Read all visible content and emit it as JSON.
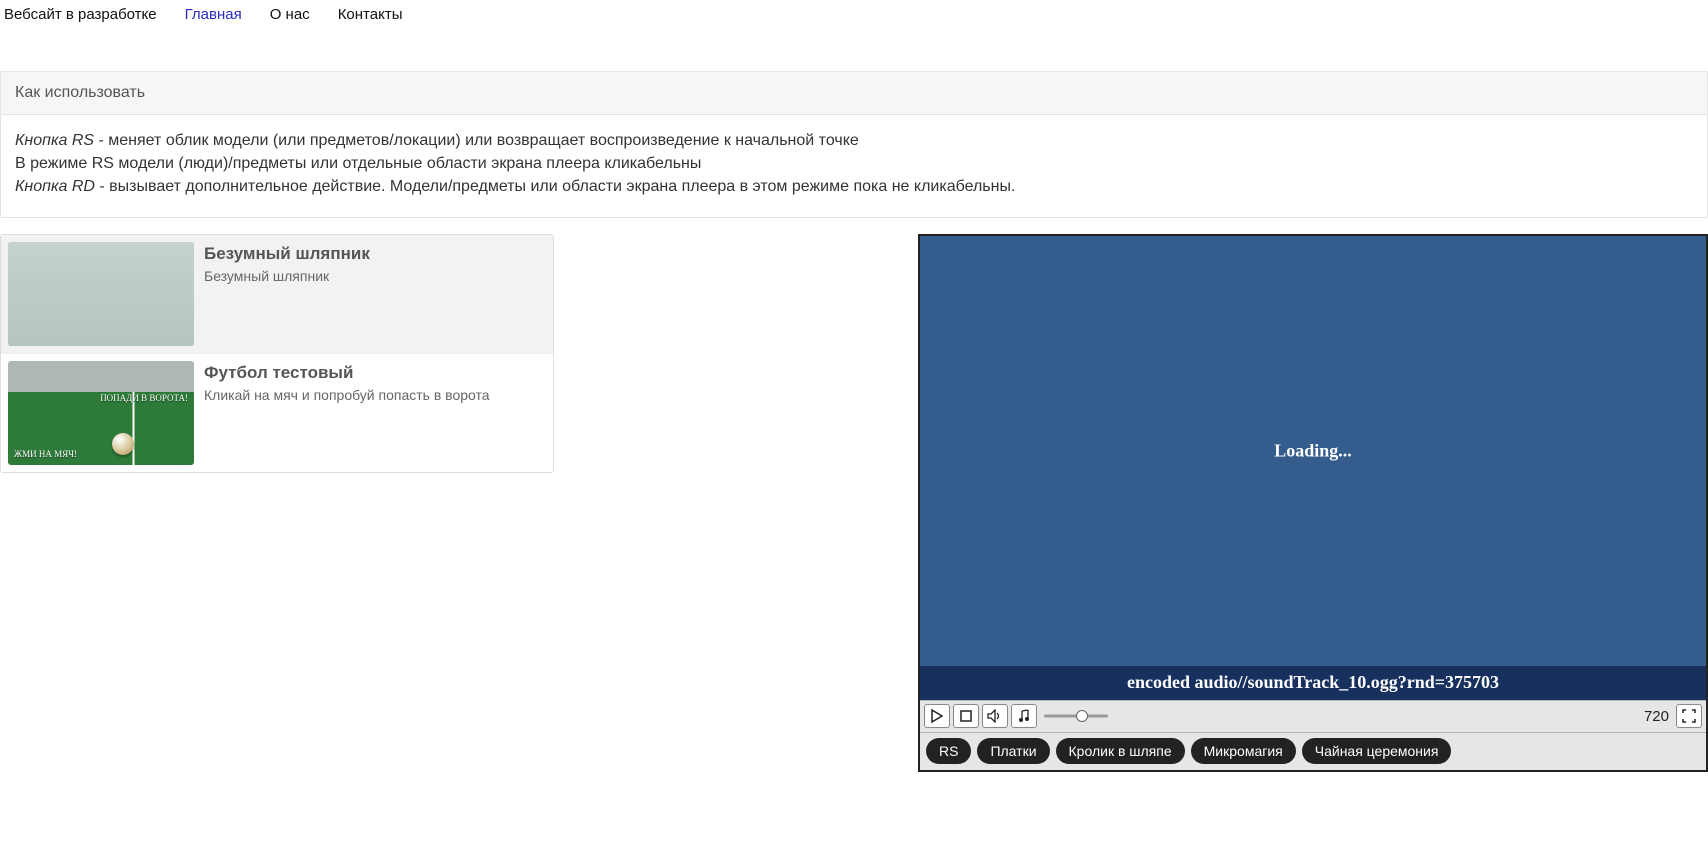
{
  "nav": {
    "brand": "Вебсайт в разработке",
    "items": [
      {
        "label": "Главная",
        "active": true
      },
      {
        "label": "О нас",
        "active": false
      },
      {
        "label": "Контакты",
        "active": false
      }
    ]
  },
  "howto": {
    "header": "Как использовать",
    "line1_em": "Кнопка RS",
    "line1_rest": " - меняет облик модели (или предметов/локации) или возвращает воспроизведение к начальной точке",
    "line2": "В режиме RS модели (люди)/предметы или отдельные области экрана плеера кликабельны",
    "line3_em": "Кнопка RD",
    "line3_rest": " - вызывает дополнительное действие. Модели/предметы или области экрана плеера в этом режиме пока не кликабельны."
  },
  "list": [
    {
      "title": "Безумный шляпник",
      "subtitle": "Безумный шляпник",
      "thumb_overlay_right": "",
      "thumb_overlay_left": ""
    },
    {
      "title": "Футбол тестовый",
      "subtitle": "Кликай на мяч и попробуй попасть в ворота",
      "thumb_overlay_right": "ПОПАДИ В ВОРОТА!",
      "thumb_overlay_left": "ЖМИ НА МЯЧ!"
    }
  ],
  "player": {
    "loading": "Loading...",
    "status": "encoded audio//soundTrack_10.ogg?rnd=375703",
    "resolution": "720",
    "pills": [
      "RS",
      "Платки",
      "Кролик в шляпе",
      "Микромагия",
      "Чайная церемония"
    ]
  }
}
